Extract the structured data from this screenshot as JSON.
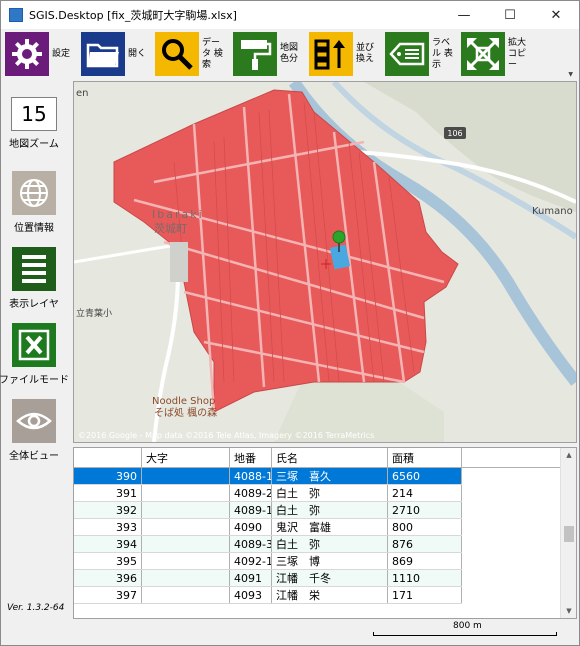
{
  "window": {
    "title": "SGIS.Desktop [fix_茨城町大字駒場.xlsx]",
    "controls": {
      "minimize": "—",
      "maximize": "☐",
      "close": "✕"
    }
  },
  "toolbar": {
    "buttons": [
      {
        "label": "設定",
        "icon": "gear-icon",
        "color": "#6b1b7a"
      },
      {
        "label": "開く",
        "icon": "folder-icon",
        "color": "#1a3a8c"
      },
      {
        "label": "データ 検索",
        "icon": "search-icon",
        "color": "#f5b800"
      },
      {
        "label": "地図 色分",
        "icon": "paint-roller-icon",
        "color": "#2c7a1e"
      },
      {
        "label": "並び 換え",
        "icon": "sort-icon",
        "color": "#f5b800"
      },
      {
        "label": "ラベル 表示",
        "icon": "tag-icon",
        "color": "#2c7a1e"
      },
      {
        "label": "拡大 コピー",
        "icon": "expand-icon",
        "color": "#2c7a1e"
      }
    ]
  },
  "sidebar": {
    "zoom_value": "15",
    "zoom_label": "地図ズーム",
    "items": [
      {
        "label": "位置情報",
        "icon": "globe-icon"
      },
      {
        "label": "表示レイヤ",
        "icon": "layers-icon"
      },
      {
        "label": "ファイルモード",
        "icon": "excel-icon"
      },
      {
        "label": "全体ビュー",
        "icon": "eye-icon"
      }
    ],
    "version": "Ver. 1.3.2-64"
  },
  "map": {
    "labels": {
      "ibaraki_en": "Ibaraki",
      "ibaraki_ja": "茨城町",
      "kumano": "Kumano",
      "route": "106",
      "school": "立青葉小",
      "shop_en": "Noodle Shop",
      "shop_ja": "そば処 楓の森",
      "corner": "en"
    },
    "attribution": "©2016 Google - Map data ©2016 Tele Atlas, Imagery ©2016 TerraMetrics",
    "colors": {
      "parcel": "#e85a5a",
      "highlight": "#4aa8e0",
      "river": "#a8c4d8",
      "road": "#ffffff",
      "marker": "#2aa52a"
    }
  },
  "table": {
    "columns": [
      "",
      "大字",
      "地番",
      "氏名",
      "面積"
    ],
    "rows": [
      {
        "id": "390",
        "oaza": "",
        "chiban": "4088-1",
        "name": "三塚　喜久",
        "area": "6560",
        "selected": true
      },
      {
        "id": "391",
        "oaza": "",
        "chiban": "4089-2",
        "name": "白土　弥",
        "area": "214"
      },
      {
        "id": "392",
        "oaza": "",
        "chiban": "4089-1",
        "name": "白土　弥",
        "area": "2710"
      },
      {
        "id": "393",
        "oaza": "",
        "chiban": "4090",
        "name": "鬼沢　富雄",
        "area": "800"
      },
      {
        "id": "394",
        "oaza": "",
        "chiban": "4089-3",
        "name": "白土　弥",
        "area": "876"
      },
      {
        "id": "395",
        "oaza": "",
        "chiban": "4092-1",
        "name": "三塚　博",
        "area": "869"
      },
      {
        "id": "396",
        "oaza": "",
        "chiban": "4091",
        "name": "江幡　千冬",
        "area": "1110"
      },
      {
        "id": "397",
        "oaza": "",
        "chiban": "4093",
        "name": "江幡　栄",
        "area": "171"
      }
    ],
    "scroll_up": "▲",
    "scroll_down": "▼"
  },
  "status": {
    "scale_label": "800 m"
  }
}
